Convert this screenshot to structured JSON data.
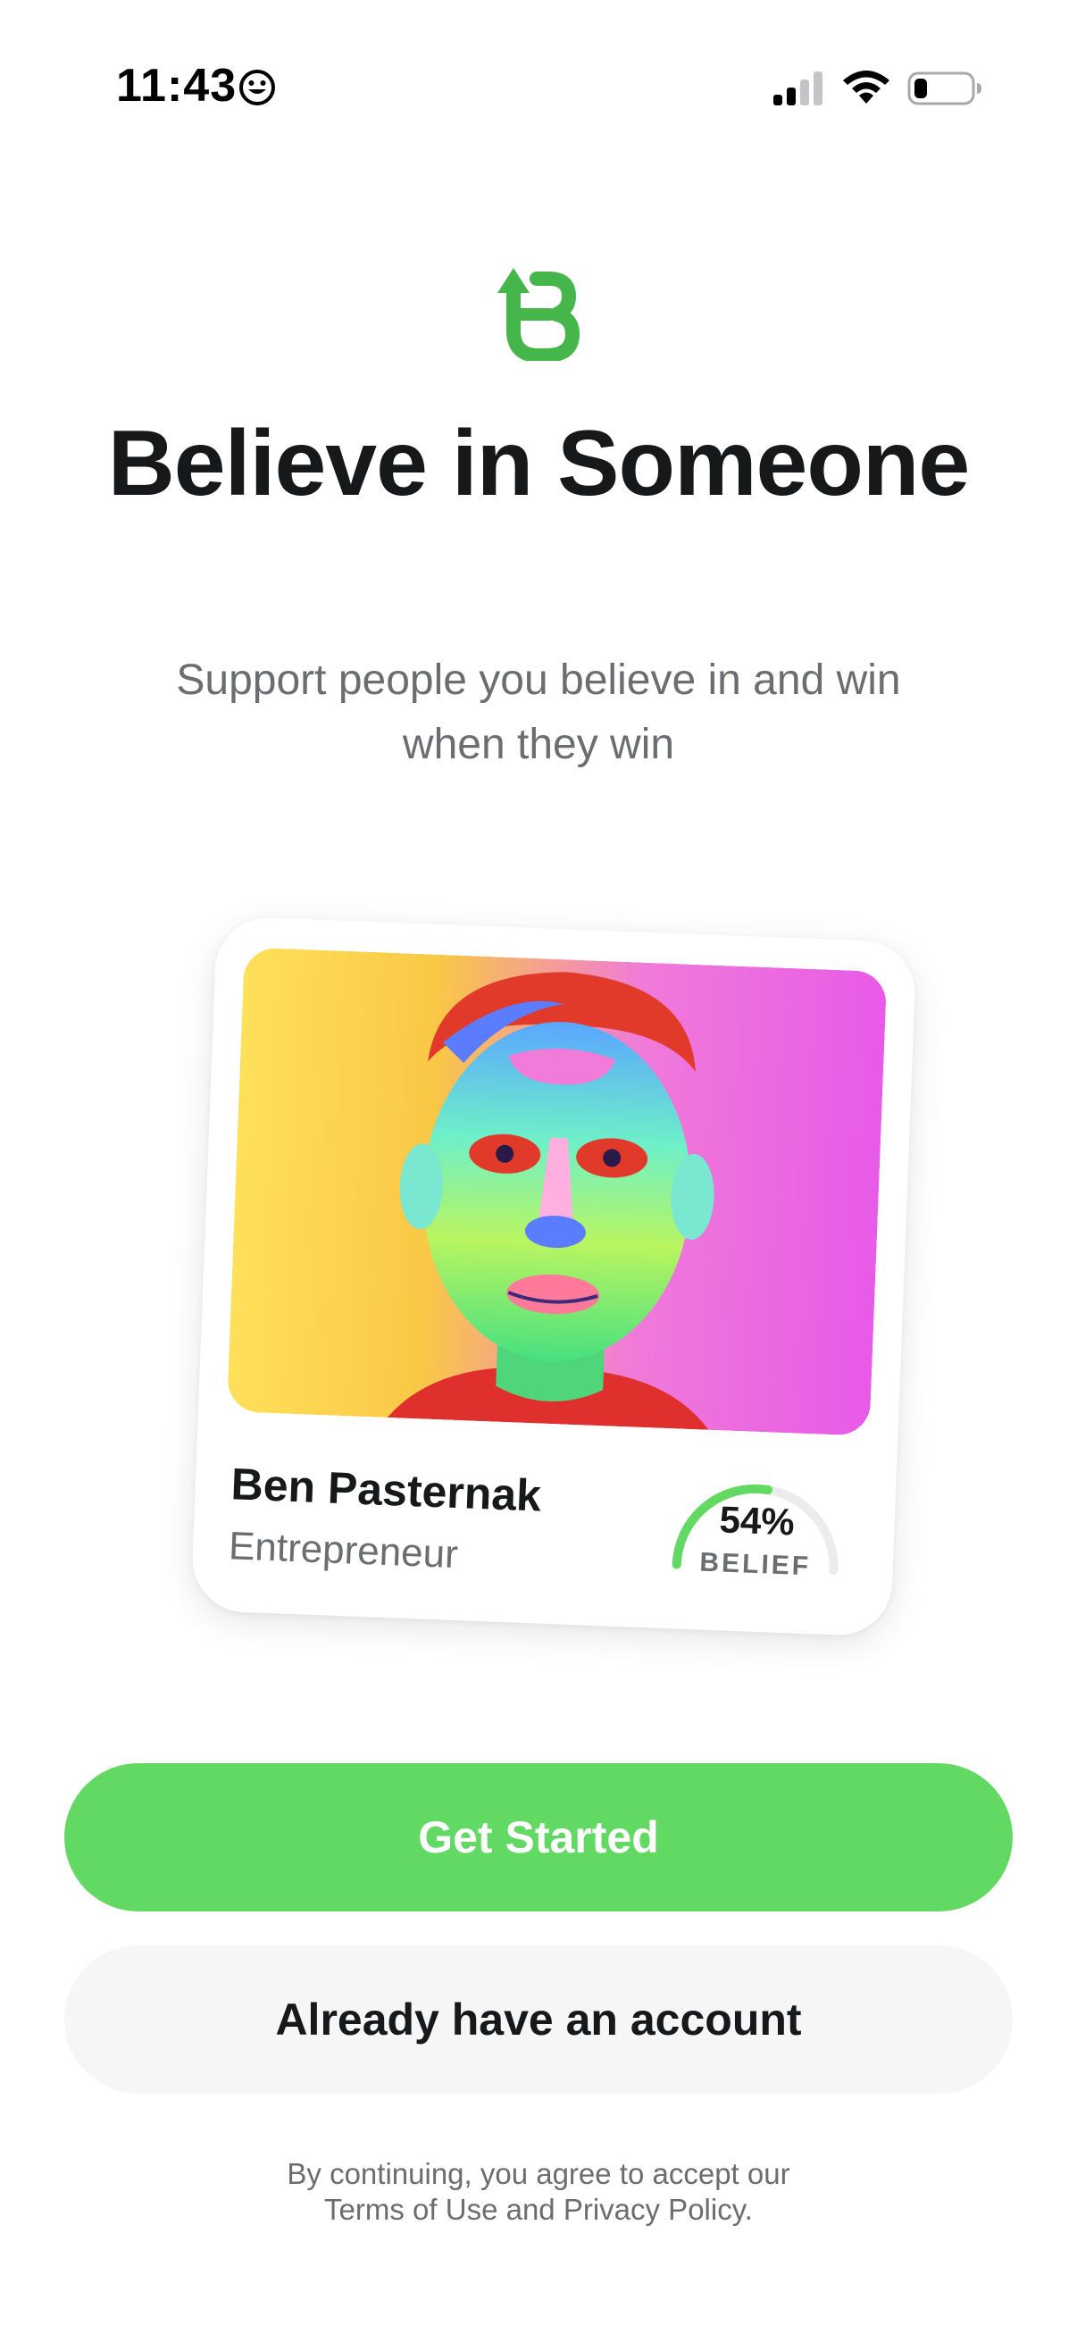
{
  "status_bar": {
    "time": "11:43",
    "icons": [
      "smiley-icon",
      "cellular-signal-icon",
      "wifi-icon",
      "battery-icon"
    ]
  },
  "brand": {
    "logo": "believe-logo-icon",
    "accent_color": "#62d962"
  },
  "hero": {
    "title": "Believe in Someone",
    "subtitle": "Support people you believe in and win when they win"
  },
  "profile_card": {
    "name": "Ben Pasternak",
    "role": "Entrepreneur",
    "belief_percent": "54%",
    "belief_fraction": 0.54,
    "belief_label": "BELIEF"
  },
  "actions": {
    "get_started": "Get Started",
    "sign_in": "Already have an account"
  },
  "legal": {
    "line1": "By continuing, you agree to accept our",
    "terms": "Terms of Use",
    "and": "and",
    "privacy": "Privacy Policy",
    "period": "."
  }
}
